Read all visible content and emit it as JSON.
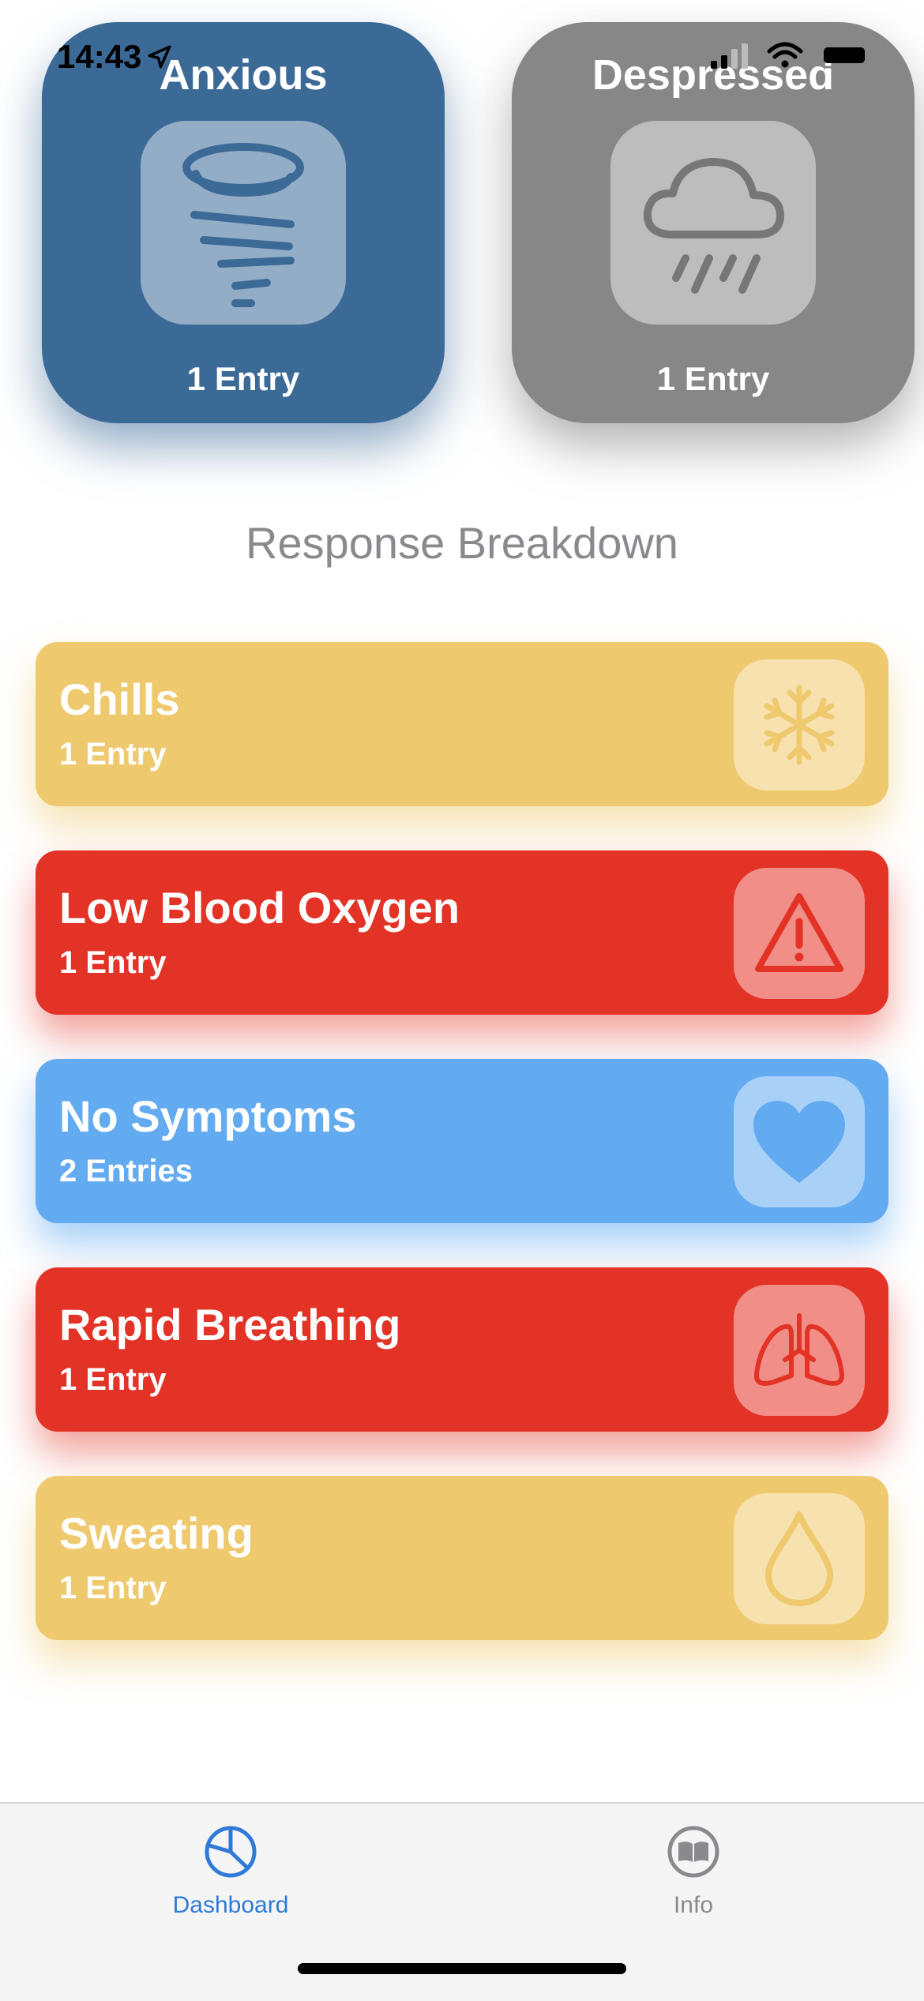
{
  "status": {
    "time": "14:43"
  },
  "moods": [
    {
      "label": "Anxious",
      "count": "1 Entry",
      "icon": "tornado-icon",
      "color": "#3c6a97"
    },
    {
      "label": "Despressed",
      "count": "1 Entry",
      "icon": "cloud-rain-icon",
      "color": "#878787"
    }
  ],
  "section_title": "Response Breakdown",
  "responses": [
    {
      "name": "Chills",
      "count": "1 Entry",
      "icon": "snowflake-icon",
      "color": "#efc96e"
    },
    {
      "name": "Low Blood Oxygen",
      "count": "1 Entry",
      "icon": "warning-icon",
      "color": "#e33226"
    },
    {
      "name": "No Symptoms",
      "count": "2 Entries",
      "icon": "heart-icon",
      "color": "#63abf1"
    },
    {
      "name": "Rapid Breathing",
      "count": "1 Entry",
      "icon": "lungs-icon",
      "color": "#e33226"
    },
    {
      "name": "Sweating",
      "count": "1 Entry",
      "icon": "drop-icon",
      "color": "#efc96e"
    }
  ],
  "tabs": [
    {
      "label": "Dashboard",
      "icon": "pie-chart-icon",
      "active": true
    },
    {
      "label": "Info",
      "icon": "book-icon",
      "active": false
    }
  ]
}
